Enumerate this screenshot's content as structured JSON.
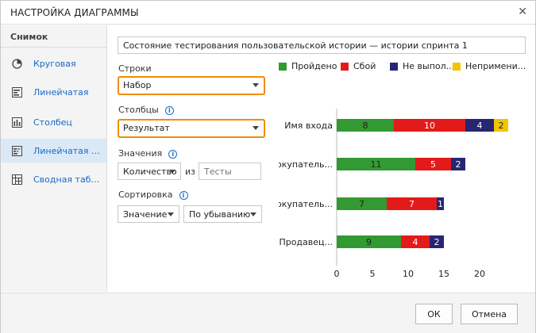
{
  "window": {
    "title": "НАСТРОЙКА ДИАГРАММЫ",
    "close_glyph": "✕"
  },
  "sidebar": {
    "header": "Снимок",
    "items": [
      {
        "label": "Круговая",
        "icon": "pie-chart-icon",
        "active": false
      },
      {
        "label": "Линейчатая",
        "icon": "bar-chart-icon",
        "active": false
      },
      {
        "label": "Столбец",
        "icon": "column-chart-icon",
        "active": false
      },
      {
        "label": "Линейчатая с накоплением",
        "icon": "stacked-bar-chart-icon",
        "active": true
      },
      {
        "label": "Сводная таблица",
        "icon": "pivot-table-icon",
        "active": false
      }
    ]
  },
  "form": {
    "chart_title_value": "Состояние тестирования пользовательской истории — истории спринта 1",
    "rows_label": "Строки",
    "rows_value": "Набор",
    "columns_label": "Столбцы",
    "columns_value": "Результат",
    "values_label": "Значения",
    "values_aggregate": "Количество",
    "values_of": "из",
    "values_field_placeholder": "Тесты",
    "sort_label": "Сортировка",
    "sort_by": "Значение",
    "sort_order": "По убыванию",
    "info_glyph": "i"
  },
  "chart_data": {
    "type": "bar",
    "orientation": "horizontal",
    "stacked": true,
    "categories": [
      "Имя входа",
      "Покупатель...",
      "Покупатель...",
      "Продавец..."
    ],
    "series": [
      {
        "name": "Пройдено",
        "color": "#339933",
        "values": [
          8,
          11,
          7,
          9
        ]
      },
      {
        "name": "Сбой",
        "color": "#e31a1a",
        "values": [
          10,
          5,
          7,
          4
        ]
      },
      {
        "name": "Не выпол...",
        "color": "#262673",
        "values": [
          4,
          2,
          1,
          2
        ]
      },
      {
        "name": "Непримени...",
        "color": "#f2c500",
        "values": [
          2,
          0,
          0,
          0
        ]
      }
    ],
    "xlim": [
      0,
      22
    ],
    "xticks": [
      0,
      5,
      10,
      15,
      20
    ],
    "legend_position": "top"
  },
  "footer": {
    "ok_label": "ОК",
    "cancel_label": "Отмена"
  }
}
